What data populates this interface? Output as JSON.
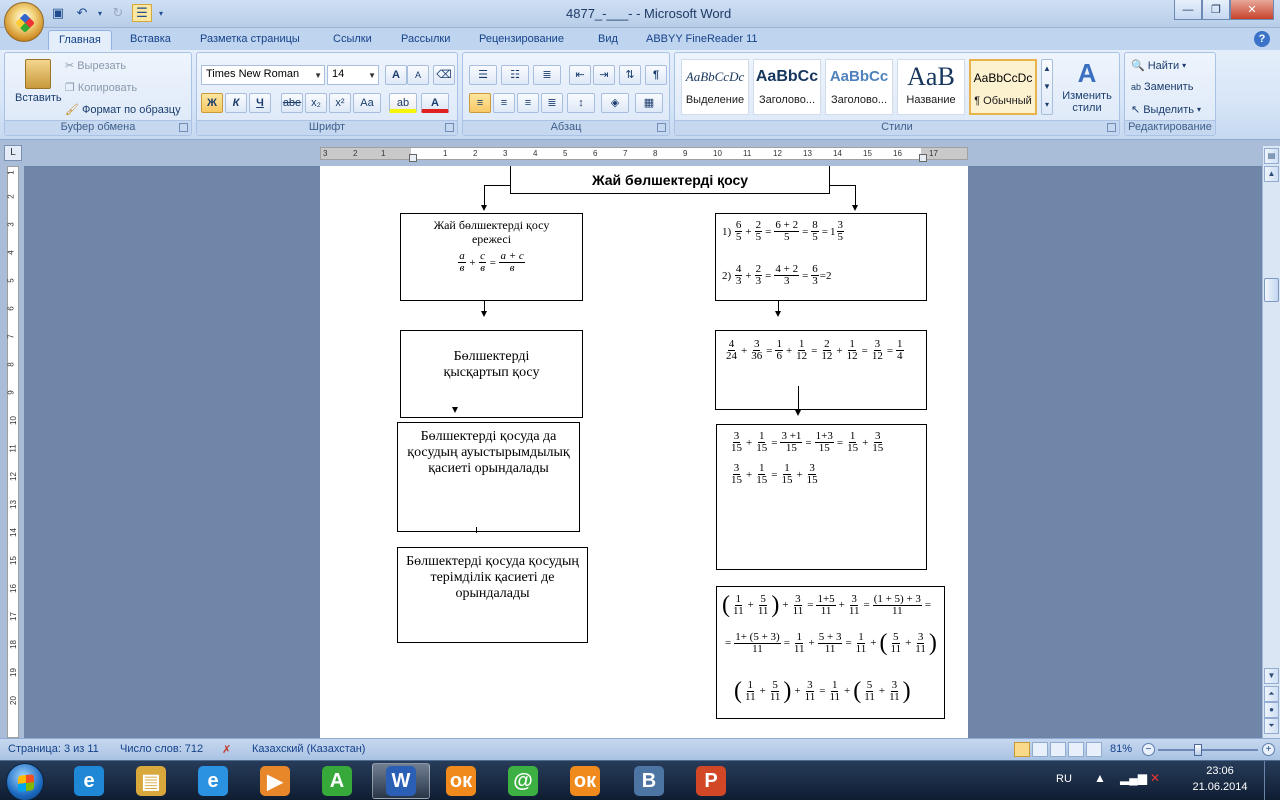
{
  "window": {
    "title": "4877_-___- - Microsoft Word"
  },
  "tabs": [
    "Главная",
    "Вставка",
    "Разметка страницы",
    "Ссылки",
    "Рассылки",
    "Рецензирование",
    "Вид",
    "ABBYY FineReader 11"
  ],
  "ribbon": {
    "clipboard": {
      "label": "Буфер обмена",
      "paste": "Вставить",
      "cut": "Вырезать",
      "copy": "Копировать",
      "format_painter": "Формат по образцу"
    },
    "font": {
      "label": "Шрифт",
      "font_name": "Times New Roman",
      "font_size": "14",
      "bold": "Ж",
      "italic": "К",
      "underline": "Ч",
      "strike": "abe",
      "subscript": "x₂",
      "superscript": "x²",
      "case": "Aa",
      "grow": "A",
      "shrink": "A"
    },
    "paragraph": {
      "label": "Абзац"
    },
    "styles": {
      "label": "Стили",
      "items": [
        {
          "preview": "AaBbCcDc",
          "name": "Выделение"
        },
        {
          "preview": "AaBbCc",
          "name": "Заголово..."
        },
        {
          "preview": "AaBbCc",
          "name": "Заголово..."
        },
        {
          "preview": "AaB",
          "name": "Название"
        },
        {
          "preview": "AaBbCcDc",
          "name": "¶ Обычный"
        }
      ],
      "change_styles": "Изменить стили"
    },
    "editing": {
      "label": "Редактирование",
      "find": "Найти",
      "replace": "Заменить",
      "select": "Выделить"
    }
  },
  "ruler": {
    "ticks": [
      "3",
      "2",
      "1",
      "1",
      "2",
      "3",
      "4",
      "5",
      "6",
      "7",
      "8",
      "9",
      "10",
      "11",
      "12",
      "13",
      "14",
      "15",
      "16",
      "17"
    ],
    "vticks": [
      "1",
      "2",
      "3",
      "4",
      "5",
      "6",
      "7",
      "8",
      "9",
      "10",
      "11",
      "12",
      "13",
      "14",
      "15",
      "16",
      "17",
      "18",
      "19",
      "20"
    ]
  },
  "document": {
    "header_box": "Жай бөлшектерді қосу",
    "rule_title": "Жай бөлшектерді қосу ережесі",
    "rule_formula": {
      "a": "а",
      "c": "с",
      "b": "в",
      "ac": "а + с"
    },
    "box_reduce": "Бөлшектерді қысқартып қосу",
    "box_commutative": "Бөлшектерді қосуда да қосудың ауыстырымдылық қасиеті орындалады",
    "box_associative": "Бөлшектерді қосуда қосудың терімділік қасиеті де орындалады",
    "example1_prefix": "1)",
    "example2_prefix": "2)",
    "example2_result": "=2"
  },
  "status": {
    "page": "Страница: 3 из 11",
    "words": "Число слов: 712",
    "language": "Казахский (Казахстан)",
    "zoom": "81%"
  },
  "taskbar": {
    "lang": "RU",
    "time": "23:06",
    "date": "21.06.2014",
    "apps": [
      {
        "name": "internet-explorer",
        "glyph": "e",
        "color": "#1e88d6"
      },
      {
        "name": "file-explorer",
        "glyph": "▤",
        "color": "#d9a83c"
      },
      {
        "name": "internet-explorer-2",
        "glyph": "e",
        "color": "#2a92e0"
      },
      {
        "name": "media-player",
        "glyph": "▶",
        "color": "#e8872a"
      },
      {
        "name": "acrobat-green",
        "glyph": "A",
        "color": "#37a83a"
      },
      {
        "name": "word",
        "glyph": "W",
        "color": "#2b5fb5"
      },
      {
        "name": "odnoklassniki",
        "glyph": "ок",
        "color": "#f08a1c"
      },
      {
        "name": "mail-agent",
        "glyph": "@",
        "color": "#3cb043"
      },
      {
        "name": "odnoklassniki-2",
        "glyph": "ок",
        "color": "#f08a1c"
      },
      {
        "name": "vkontakte",
        "glyph": "В",
        "color": "#4c75a3"
      },
      {
        "name": "powerpoint",
        "glyph": "P",
        "color": "#d24726"
      }
    ]
  }
}
